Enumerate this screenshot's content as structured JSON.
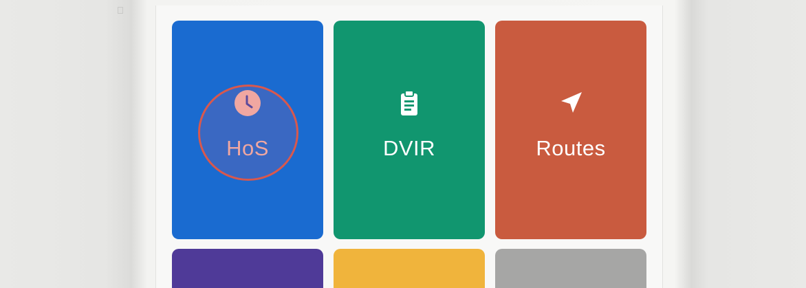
{
  "tiles": [
    {
      "label": "HoS",
      "icon": "clock-icon",
      "color": "#1a6bd0",
      "highlighted": true,
      "highlight_color": "#d9584d"
    },
    {
      "label": "DVIR",
      "icon": "clipboard-icon",
      "color": "#11966f"
    },
    {
      "label": "Routes",
      "icon": "navigation-arrow-icon",
      "color": "#c95b3f"
    }
  ],
  "bottom_tiles": [
    {
      "color": "#4f3a98"
    },
    {
      "color": "#f0b43c"
    },
    {
      "color": "#a6a6a5"
    }
  ]
}
